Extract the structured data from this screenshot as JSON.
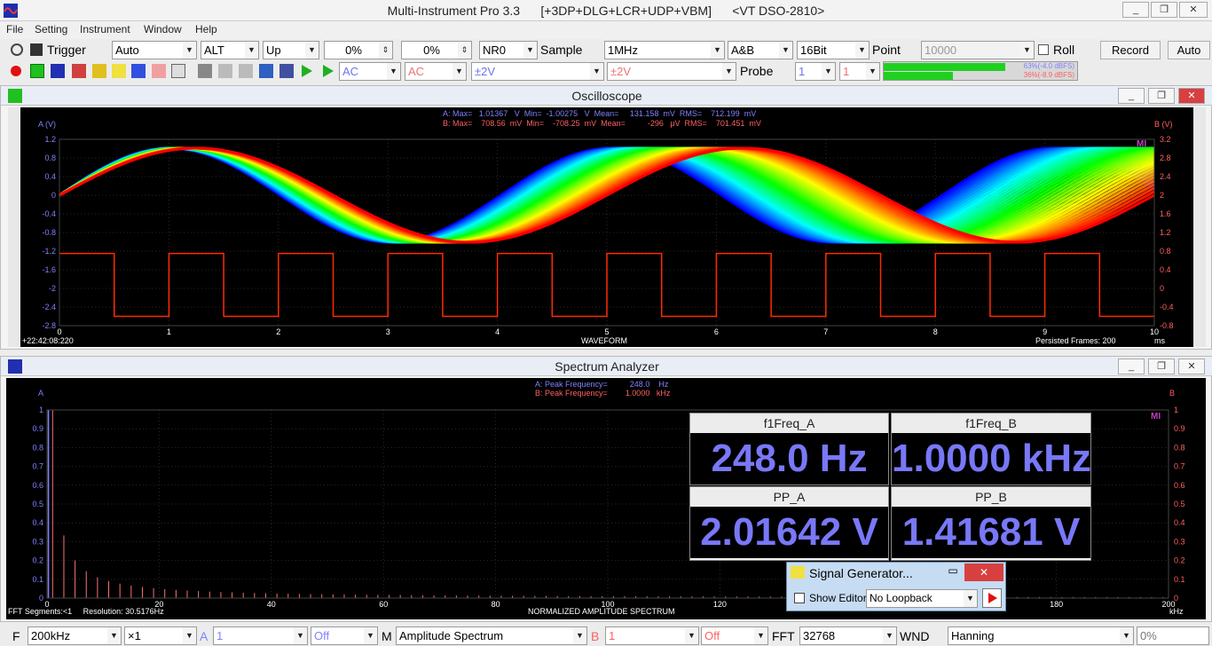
{
  "app": {
    "title": "Multi-Instrument Pro 3.3      [+3DP+DLG+LCR+UDP+VBM]      <VT DSO-2810>",
    "window_buttons": [
      "_",
      "❐",
      "✕"
    ]
  },
  "menu": [
    "File",
    "Setting",
    "Instrument",
    "Window",
    "Help"
  ],
  "toolbar1": {
    "trigger_label": "Trigger",
    "trigger_mode": "Auto",
    "trigger_source": "ALT",
    "trigger_edge": "Up",
    "pct1": "0%",
    "pct2": "0%",
    "nr": "NR0",
    "sample_label": "Sample",
    "sample_rate": "1MHz",
    "channels": "A&B",
    "bits": "16Bit",
    "point_label": "Point",
    "point_value": "10000",
    "roll_label": "Roll",
    "record_label": "Record",
    "auto_label": "Auto"
  },
  "toolbar2": {
    "coupling_a": "AC",
    "coupling_b": "AC",
    "range_a": "±2V",
    "range_b": "±2V",
    "probe_label": "Probe",
    "probe_a": "1",
    "probe_b": "1",
    "level_a": "63%(-4.0 dBFS)",
    "level_b": "36%(-8.9 dBFS)",
    "level_a_frac": 0.63,
    "level_b_frac": 0.36
  },
  "scope": {
    "title": "Oscilloscope",
    "ylabel_a": "A (V)",
    "ylabel_b": "B (V)",
    "stats_a": "A: Max=   1.01367   V  Min=  -1.00275   V  Mean=     131.158  mV  RMS=    712.199  mV",
    "stats_b": "B: Max=    708.56  mV  Min=    -708.25  mV  Mean=          -296   μV  RMS=    701.451  mV",
    "yticks_a": [
      "1.2",
      "0.8",
      "0.4",
      "0",
      "-0.4",
      "-0.8",
      "-1.2",
      "-1.6",
      "-2",
      "-2.4",
      "-2.8"
    ],
    "yticks_b": [
      "3.2",
      "2.8",
      "2.4",
      "2",
      "1.6",
      "1.2",
      "0.8",
      "0.4",
      "0",
      "-0.4",
      "-0.8"
    ],
    "xticks": [
      "0",
      "1",
      "2",
      "3",
      "4",
      "5",
      "6",
      "7",
      "8",
      "9",
      "10"
    ],
    "xunit": "ms",
    "timestamp": "+22:42:08:220",
    "xlabel": "WAVEFORM",
    "persisted": "Persisted Frames: 200",
    "mi": "MI"
  },
  "spectrum": {
    "title": "Spectrum Analyzer",
    "ylabel_a": "A",
    "ylabel_b": "B",
    "peak_a": "A: Peak Frequency=          248.0    Hz",
    "peak_b": "B: Peak Frequency=        1.0000   kHz",
    "yticks": [
      "1",
      "0.9",
      "0.8",
      "0.7",
      "0.6",
      "0.5",
      "0.4",
      "0.3",
      "0.2",
      "0.1",
      "0"
    ],
    "xticks": [
      "0",
      "20",
      "40",
      "60",
      "80",
      "100",
      "120",
      "140",
      "160",
      "180",
      "200"
    ],
    "xunit": "kHz",
    "fft_info": "FFT Segments:<1     Resolution: 30.5176Hz",
    "xlabel": "NORMALIZED AMPLITUDE SPECTRUM",
    "mi": "MI"
  },
  "meters": [
    {
      "title": "f1Freq_A",
      "value": "248.0  Hz"
    },
    {
      "title": "f1Freq_B",
      "value": "1.0000  kHz"
    },
    {
      "title": "PP_A",
      "value": "2.01642  V"
    },
    {
      "title": "PP_B",
      "value": "1.41681  V"
    }
  ],
  "siggen": {
    "title": "Signal Generator...",
    "show_editor": "Show Editor",
    "loopback": "No Loopback"
  },
  "status": {
    "f_label": "F",
    "f_value": "200kHz",
    "zoom": "×1",
    "a_label": "A",
    "a_value": "1",
    "a_off": "Off",
    "m_label": "M",
    "mode": "Amplitude Spectrum",
    "b_label": "B",
    "b_value": "1",
    "b_off": "Off",
    "fft_label": "FFT",
    "fft_value": "32768",
    "wnd_label": "WND",
    "window": "Hanning",
    "pct": "0%"
  },
  "colors": {
    "plot_bg": "#000000",
    "channel_a": "#8080ff",
    "channel_b": "#ff6060",
    "square_wave": "#ff2a00",
    "grid": "#2a2a2a"
  }
}
